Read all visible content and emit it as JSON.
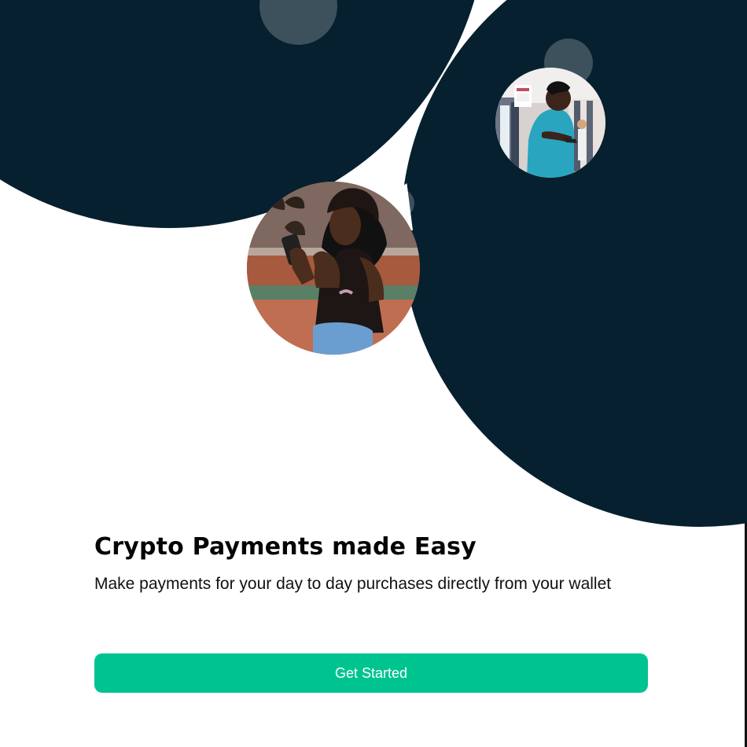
{
  "screen": {
    "title": "Crypto Payments made Easy",
    "description": "Make payments for your day to day purchases directly from your wallet",
    "cta_label": "Get Started"
  },
  "images": {
    "man_photo_name": "man-using-phone-photo",
    "woman_photo_name": "woman-holding-phone-photo"
  },
  "colors": {
    "background": "#ffffff",
    "dark_blob": "#06202f",
    "button": "#00c490",
    "button_text": "#ffffff",
    "text": "#050505"
  }
}
